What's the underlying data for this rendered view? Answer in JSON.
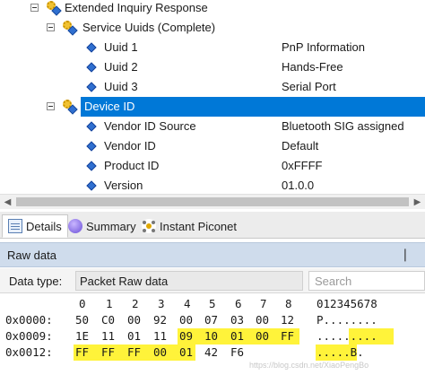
{
  "tree": {
    "rows": [
      {
        "label": "Extended Inquiry Response",
        "value": ""
      },
      {
        "label": "Service Uuids (Complete)",
        "value": ""
      },
      {
        "label": "Uuid 1",
        "value": "PnP Information"
      },
      {
        "label": "Uuid 2",
        "value": "Hands-Free"
      },
      {
        "label": "Uuid 3",
        "value": "Serial Port"
      },
      {
        "label": "Device ID",
        "value": ""
      },
      {
        "label": "Vendor ID Source",
        "value": "Bluetooth SIG assigned"
      },
      {
        "label": "Vendor ID",
        "value": "Default"
      },
      {
        "label": "Product ID",
        "value": "0xFFFF"
      },
      {
        "label": "Version",
        "value": "01.0.0"
      }
    ]
  },
  "tabs": [
    {
      "label": "Details"
    },
    {
      "label": "Summary"
    },
    {
      "label": "Instant Piconet"
    }
  ],
  "raw": {
    "title": "Raw data",
    "pin_glyph": "❘",
    "data_type_label": "Data type:",
    "data_type_value": "Packet Raw data",
    "search_placeholder": "Search",
    "column_header": [
      "0",
      "1",
      "2",
      "3",
      "4",
      "5",
      "6",
      "7",
      "8"
    ],
    "ascii_header": "012345678",
    "rows": [
      {
        "offset": "0x0000:",
        "bytes": [
          "50",
          "C0",
          "00",
          "92",
          "00",
          "07",
          "03",
          "00",
          "12"
        ],
        "ascii": "P........"
      },
      {
        "offset": "0x0009:",
        "bytes": [
          "1E",
          "11",
          "01",
          "11",
          "09",
          "10",
          "01",
          "00",
          "FF"
        ],
        "ascii": "........."
      },
      {
        "offset": "0x0012:",
        "bytes": [
          "FF",
          "FF",
          "FF",
          "00",
          "01",
          "42",
          "F6",
          "",
          ""
        ],
        "ascii": ".....B."
      }
    ]
  },
  "watermark": "https://blog.csdn.net/XiaoPengBo"
}
